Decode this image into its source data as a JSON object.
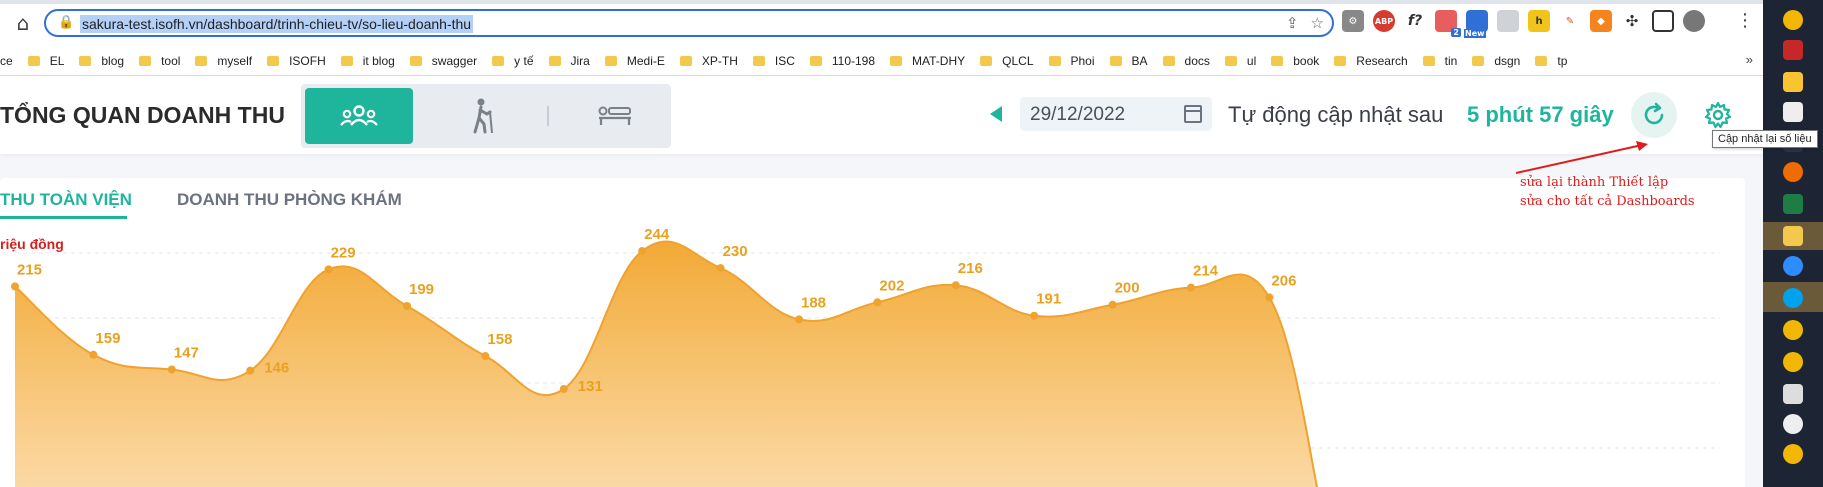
{
  "browser": {
    "url": "sakura-test.isofh.vn/dashboard/trinh-chieu-tv/so-lieu-doanh-thu",
    "bookmarks": [
      "ce",
      "EL",
      "blog",
      "tool",
      "myself",
      "ISOFH",
      "it blog",
      "swagger",
      "y tế",
      "Jira",
      "Medi-E",
      "XP-TH",
      "ISC",
      "110-198",
      "MAT-DHY",
      "QLCL",
      "Phoi",
      "BA",
      "docs",
      "ul",
      "book",
      "Research",
      "tin",
      "dsgn",
      "tp"
    ],
    "more": "»",
    "ext_badge_1": "ABP",
    "ext_badge_2": "f?",
    "ext_badge_3": "2",
    "ext_badge_4": "New"
  },
  "header": {
    "title": "TỔNG QUAN DOANH THU",
    "date": "29/12/2022",
    "auto_update_label": "Tự động cập nhật sau",
    "auto_update_time": "5 phút 57 giây",
    "tooltip": "Cập nhật lại số liệu"
  },
  "tabs": {
    "active": "THU TOÀN VIỆN",
    "inactive": "DOANH THU PHÒNG KHÁM"
  },
  "annotation": {
    "line1": "sửa lại thành Thiết lập",
    "line2": "sửa cho tất cả Dashboards"
  },
  "colors": {
    "accent": "#1fb59d",
    "line": "#f0a22e",
    "label": "#e8a21f",
    "annotation": "#e01b1b"
  },
  "chart_data": {
    "type": "area",
    "ylabel": "riệu đồng",
    "values": [
      215,
      159,
      147,
      146,
      229,
      199,
      158,
      131,
      244,
      230,
      188,
      202,
      216,
      191,
      200,
      214,
      206
    ]
  }
}
